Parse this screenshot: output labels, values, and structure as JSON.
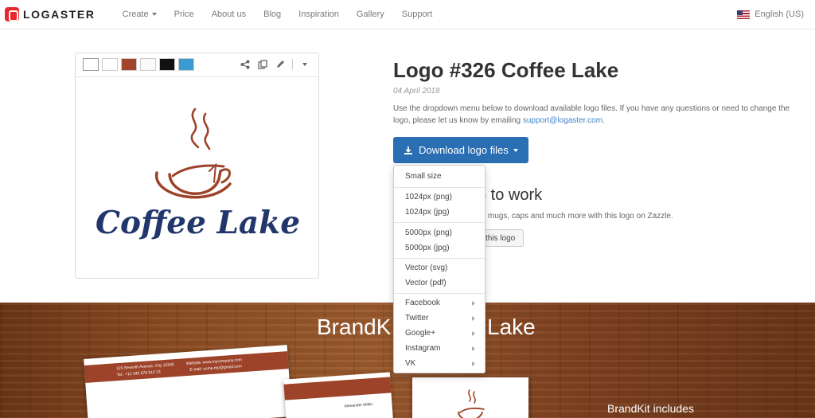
{
  "nav": {
    "brand": "LOGASTER",
    "links": [
      "Create",
      "Price",
      "About us",
      "Blog",
      "Inspiration",
      "Gallery",
      "Support"
    ],
    "language": "English (US)"
  },
  "logo": {
    "wordmark": "Coffee Lake",
    "brand_color": "#21376b",
    "accent_color": "#9d4329"
  },
  "details": {
    "title": "Logo #326 Coffee Lake",
    "date": "04 April 2018",
    "description": "Use the dropdown menu below to download available logo files. If you have any questions or need to change the logo, please let us know by emailing",
    "email": "support@logaster.com",
    "email_suffix": ".",
    "download_label": "Download logo files",
    "partial_heading": "o to work",
    "partial_text": "irts, mugs, caps and much more with this logo on Zazzle.",
    "partial_button": "this logo"
  },
  "menu": {
    "items": [
      "Small size",
      "1024px (png)",
      "1024px (jpg)",
      "5000px (png)",
      "5000px (jpg)",
      "Vector (svg)",
      "Vector (pdf)",
      "Facebook",
      "Twitter",
      "Google+",
      "Instagram",
      "VK"
    ]
  },
  "brandkit": {
    "title_left": "BrandK",
    "title_right": "Lake",
    "includes": "BrandKit includes",
    "letterhead_address": "123 Seventh Avenue, City 12345",
    "letterhead_phone": "Tel.: +12 345 678 910 23",
    "letterhead_web": "Website: www.mycompany.com",
    "letterhead_email": "E-mail: some.mp@gmail.com",
    "card_name": "Alexander Miller"
  }
}
